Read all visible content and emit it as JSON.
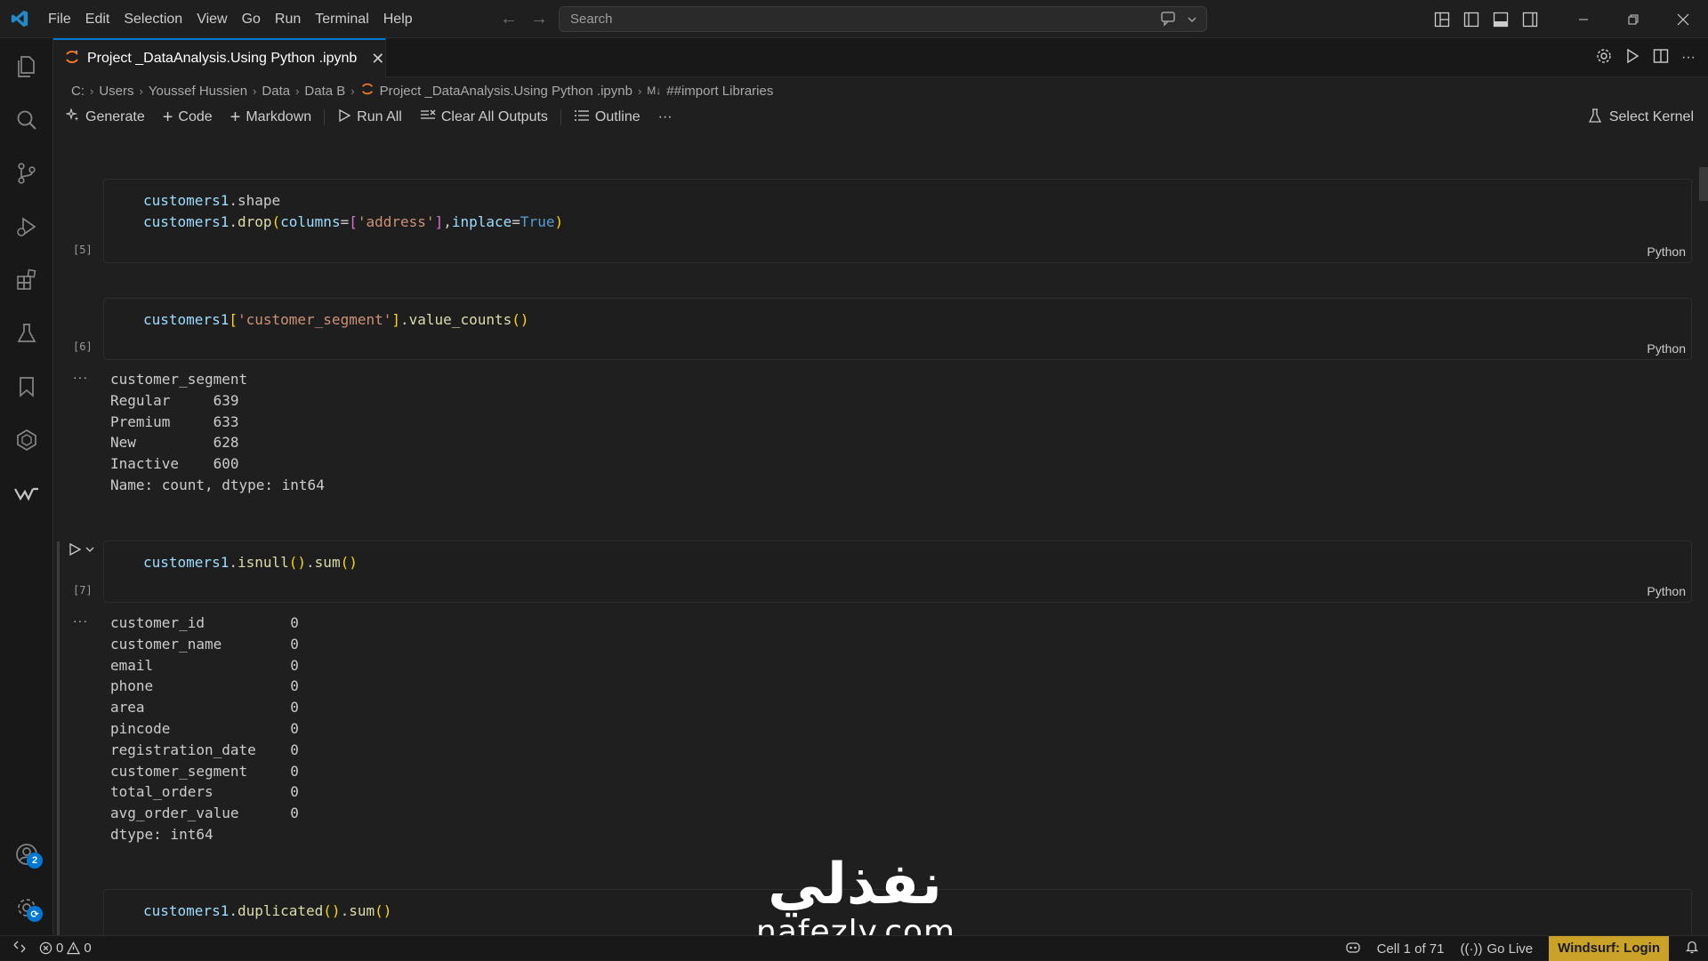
{
  "titlebar": {
    "menus": [
      "File",
      "Edit",
      "Selection",
      "View",
      "Go",
      "Run",
      "Terminal",
      "Help"
    ],
    "search_placeholder": "Search"
  },
  "tab": {
    "title": "Project _DataAnalysis.Using Python .ipynb"
  },
  "breadcrumb": [
    "C:",
    "Users",
    "Youssef Hussien",
    "Data",
    "Data B",
    "Project _DataAnalysis.Using Python .ipynb",
    "##import Libraries"
  ],
  "toolbar": {
    "generate": "Generate",
    "code": "Code",
    "markdown": "Markdown",
    "run_all": "Run All",
    "clear_outputs": "Clear All Outputs",
    "outline": "Outline",
    "more": "···",
    "select_kernel": "Select Kernel"
  },
  "cells": [
    {
      "count": "[5]",
      "language": "Python",
      "lines": [
        "customers1.shape",
        "customers1.drop(columns=['address'],inplace=True)"
      ]
    },
    {
      "count": "[6]",
      "language": "Python",
      "lines": [
        "customers1['customer_segment'].value_counts()"
      ],
      "output": [
        "customer_segment",
        "Regular     639",
        "Premium     633",
        "New         628",
        "Inactive    600",
        "Name: count, dtype: int64"
      ]
    },
    {
      "count": "[7]",
      "language": "Python",
      "lines": [
        "customers1.isnull().sum()"
      ],
      "output": [
        "customer_id          0",
        "customer_name        0",
        "email                0",
        "phone                0",
        "area                 0",
        "pincode              0",
        "registration_date    0",
        "customer_segment     0",
        "total_orders         0",
        "avg_order_value      0",
        "dtype: int64"
      ]
    },
    {
      "lines": [
        "customers1.duplicated().sum()"
      ]
    }
  ],
  "output_dots": "···",
  "watermark": {
    "arabic": "نفذلي",
    "latin": "nafezly.com"
  },
  "statusbar": {
    "errors": "0",
    "warnings": "0",
    "cell_pos": "Cell 1 of 71",
    "go_live": "Go Live",
    "windsurf": "Windsurf: Login"
  },
  "activity_badge": "2",
  "colors": {
    "accent": "#0078d4",
    "windsurf_bg": "#c9a227"
  },
  "icons": [
    "vscode-logo-icon",
    "explorer-icon",
    "search-icon",
    "source-control-icon",
    "run-debug-icon",
    "extensions-icon",
    "testing-icon",
    "bookmark-icon",
    "kubernetes-icon",
    "windsurf-icon",
    "accounts-icon",
    "manage-icon"
  ]
}
